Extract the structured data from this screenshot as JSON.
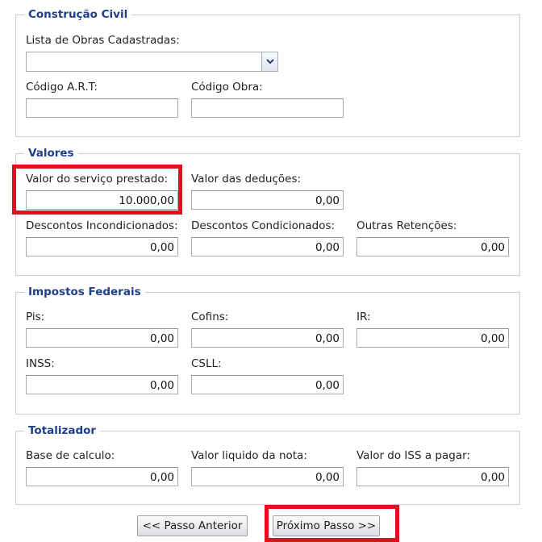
{
  "construcao": {
    "legend": "Construção Civil",
    "lista_label": "Lista de Obras Cadastradas:",
    "lista_value": "",
    "art_label": "Código A.R.T:",
    "art_value": "",
    "obra_label": "Código Obra:",
    "obra_value": ""
  },
  "valores": {
    "legend": "Valores",
    "servico_label": "Valor do serviço prestado:",
    "servico_value": "10.000,00",
    "deducoes_label": "Valor das deduções:",
    "deducoes_value": "0,00",
    "desc_incond_label": "Descontos Incondicionados:",
    "desc_incond_value": "0,00",
    "desc_cond_label": "Descontos Condicionados:",
    "desc_cond_value": "0,00",
    "outras_label": "Outras Retenções:",
    "outras_value": "0,00"
  },
  "impostos": {
    "legend": "Impostos Federais",
    "pis_label": "Pis:",
    "pis_value": "0,00",
    "cofins_label": "Cofins:",
    "cofins_value": "0,00",
    "ir_label": "IR:",
    "ir_value": "0,00",
    "inss_label": "INSS:",
    "inss_value": "0,00",
    "csll_label": "CSLL:",
    "csll_value": "0,00"
  },
  "totalizador": {
    "legend": "Totalizador",
    "base_label": "Base de calculo:",
    "base_value": "0,00",
    "liquido_label": "Valor liquido da nota:",
    "liquido_value": "0,00",
    "iss_label": "Valor do ISS a pagar:",
    "iss_value": "0,00"
  },
  "nav": {
    "prev_label": "<< Passo Anterior",
    "next_label": "Próximo Passo >>"
  },
  "colors": {
    "legend_text": "#1f3f8a",
    "highlight": "#e0101f",
    "fieldset_border": "#c9ccd3"
  }
}
